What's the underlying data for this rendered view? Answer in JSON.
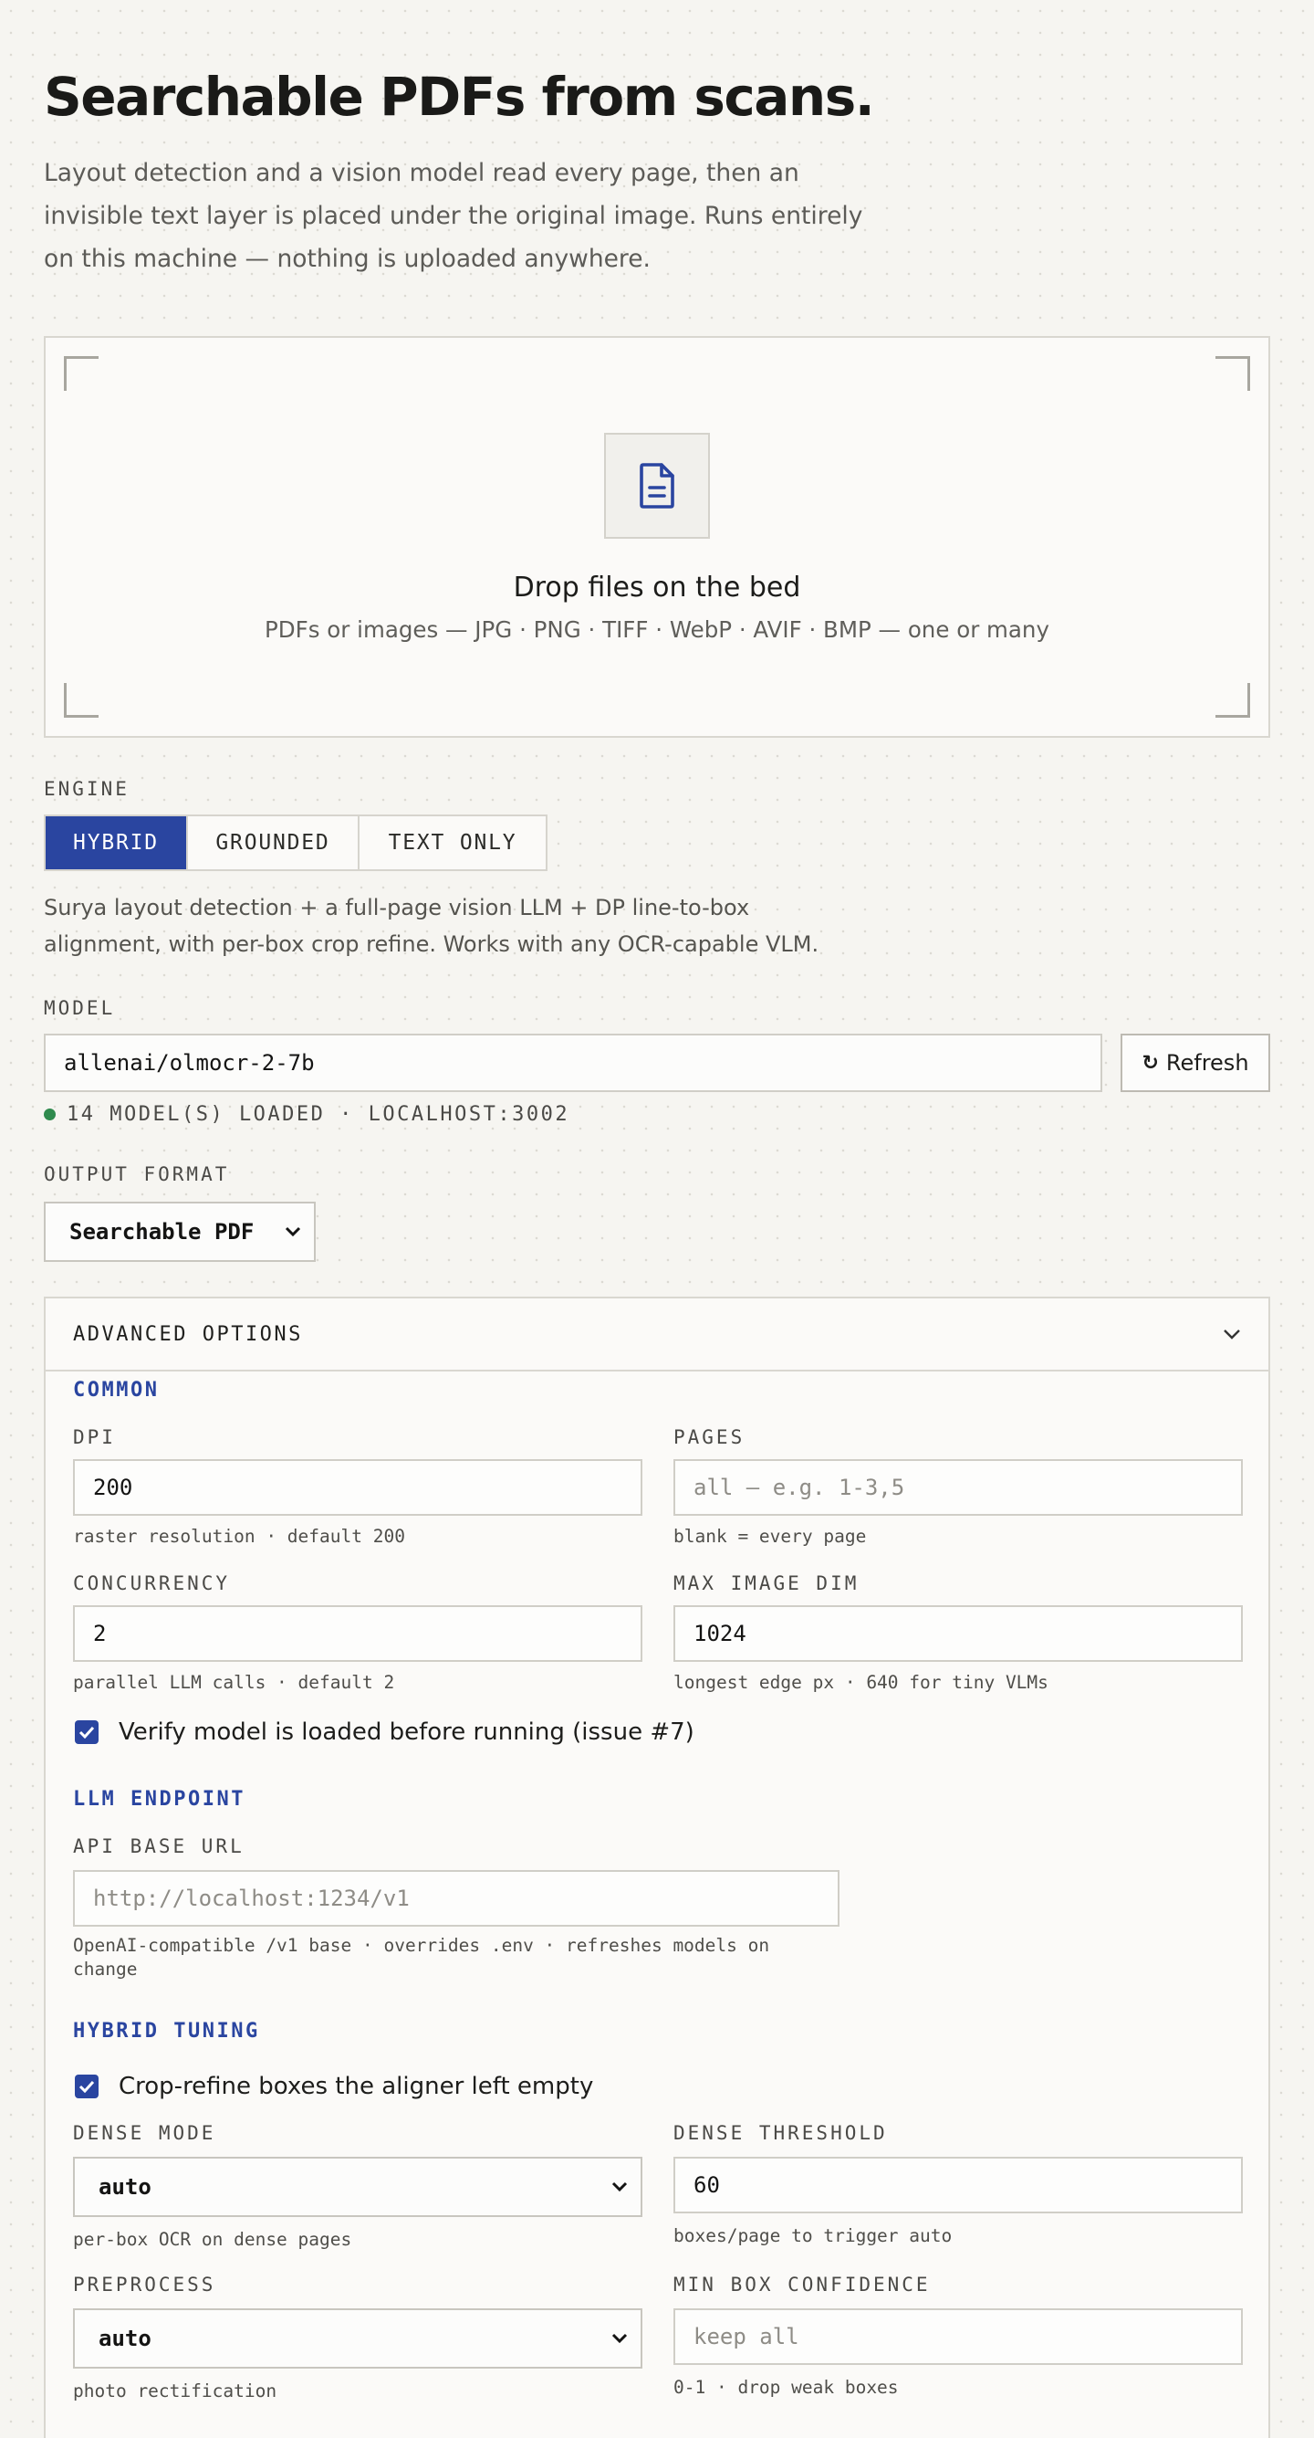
{
  "header": {
    "title": "Searchable PDFs from scans.",
    "intro_lines": [
      "Layout detection and a vision model read every page, then an",
      "invisible text layer is placed under the original image. Runs entirely",
      "on this machine — nothing is uploaded anywhere."
    ]
  },
  "dropzone": {
    "title": "Drop files on the bed",
    "subtitle": "PDFs or images — JPG · PNG · TIFF · WebP · AVIF · BMP — one or many",
    "icon": "file-text-icon"
  },
  "engine": {
    "label": "ENGINE",
    "options": [
      "HYBRID",
      "GROUNDED",
      "TEXT ONLY"
    ],
    "selected": "HYBRID",
    "description_lines": [
      "Surya layout detection + a full-page vision LLM + DP line-to-box",
      "alignment, with per-box crop refine. Works with any OCR-capable VLM."
    ]
  },
  "model": {
    "label": "MODEL",
    "value": "allenai/olmocr-2-7b",
    "refresh_label": "Refresh",
    "refresh_icon": "↻",
    "status": "14 MODEL(S) LOADED · LOCALHOST:3002",
    "status_color": "#2f8a4d"
  },
  "output": {
    "label": "OUTPUT FORMAT",
    "value": "Searchable PDF"
  },
  "advanced": {
    "title": "ADVANCED OPTIONS",
    "common": {
      "heading": "COMMON",
      "dpi": {
        "label": "DPI",
        "value": "200",
        "hint": "raster resolution · default 200"
      },
      "pages": {
        "label": "PAGES",
        "placeholder": "all — e.g. 1-3,5",
        "hint": "blank = every page"
      },
      "concurrency": {
        "label": "CONCURRENCY",
        "value": "2",
        "hint": "parallel LLM calls · default 2"
      },
      "max_image_dim": {
        "label": "MAX IMAGE DIM",
        "value": "1024",
        "hint": "longest edge px · 640 for tiny VLMs"
      },
      "verify": {
        "label": "Verify model is loaded before running (issue #7)",
        "checked": true
      }
    },
    "llm": {
      "heading": "LLM ENDPOINT",
      "api_base": {
        "label": "API BASE URL",
        "placeholder": "http://localhost:1234/v1",
        "hint_lines": [
          "OpenAI-compatible /v1 base · overrides .env · refreshes models on",
          "change"
        ]
      }
    },
    "hybrid": {
      "heading": "HYBRID TUNING",
      "crop_refine": {
        "label": "Crop-refine boxes the aligner left empty",
        "checked": true
      },
      "dense_mode": {
        "label": "DENSE MODE",
        "value": "auto",
        "hint": "per-box OCR on dense pages"
      },
      "dense_threshold": {
        "label": "DENSE THRESHOLD",
        "value": "60",
        "hint": "boxes/page to trigger auto"
      },
      "preprocess": {
        "label": "PREPROCESS",
        "value": "auto",
        "hint": "photo rectification"
      },
      "min_box_conf": {
        "label": "MIN BOX CONFIDENCE",
        "placeholder": "keep all",
        "hint": "0-1 · drop weak boxes"
      }
    }
  },
  "colors": {
    "accent": "#2a45a0",
    "background": "#f6f5f1",
    "status_green": "#2f8a4d"
  }
}
